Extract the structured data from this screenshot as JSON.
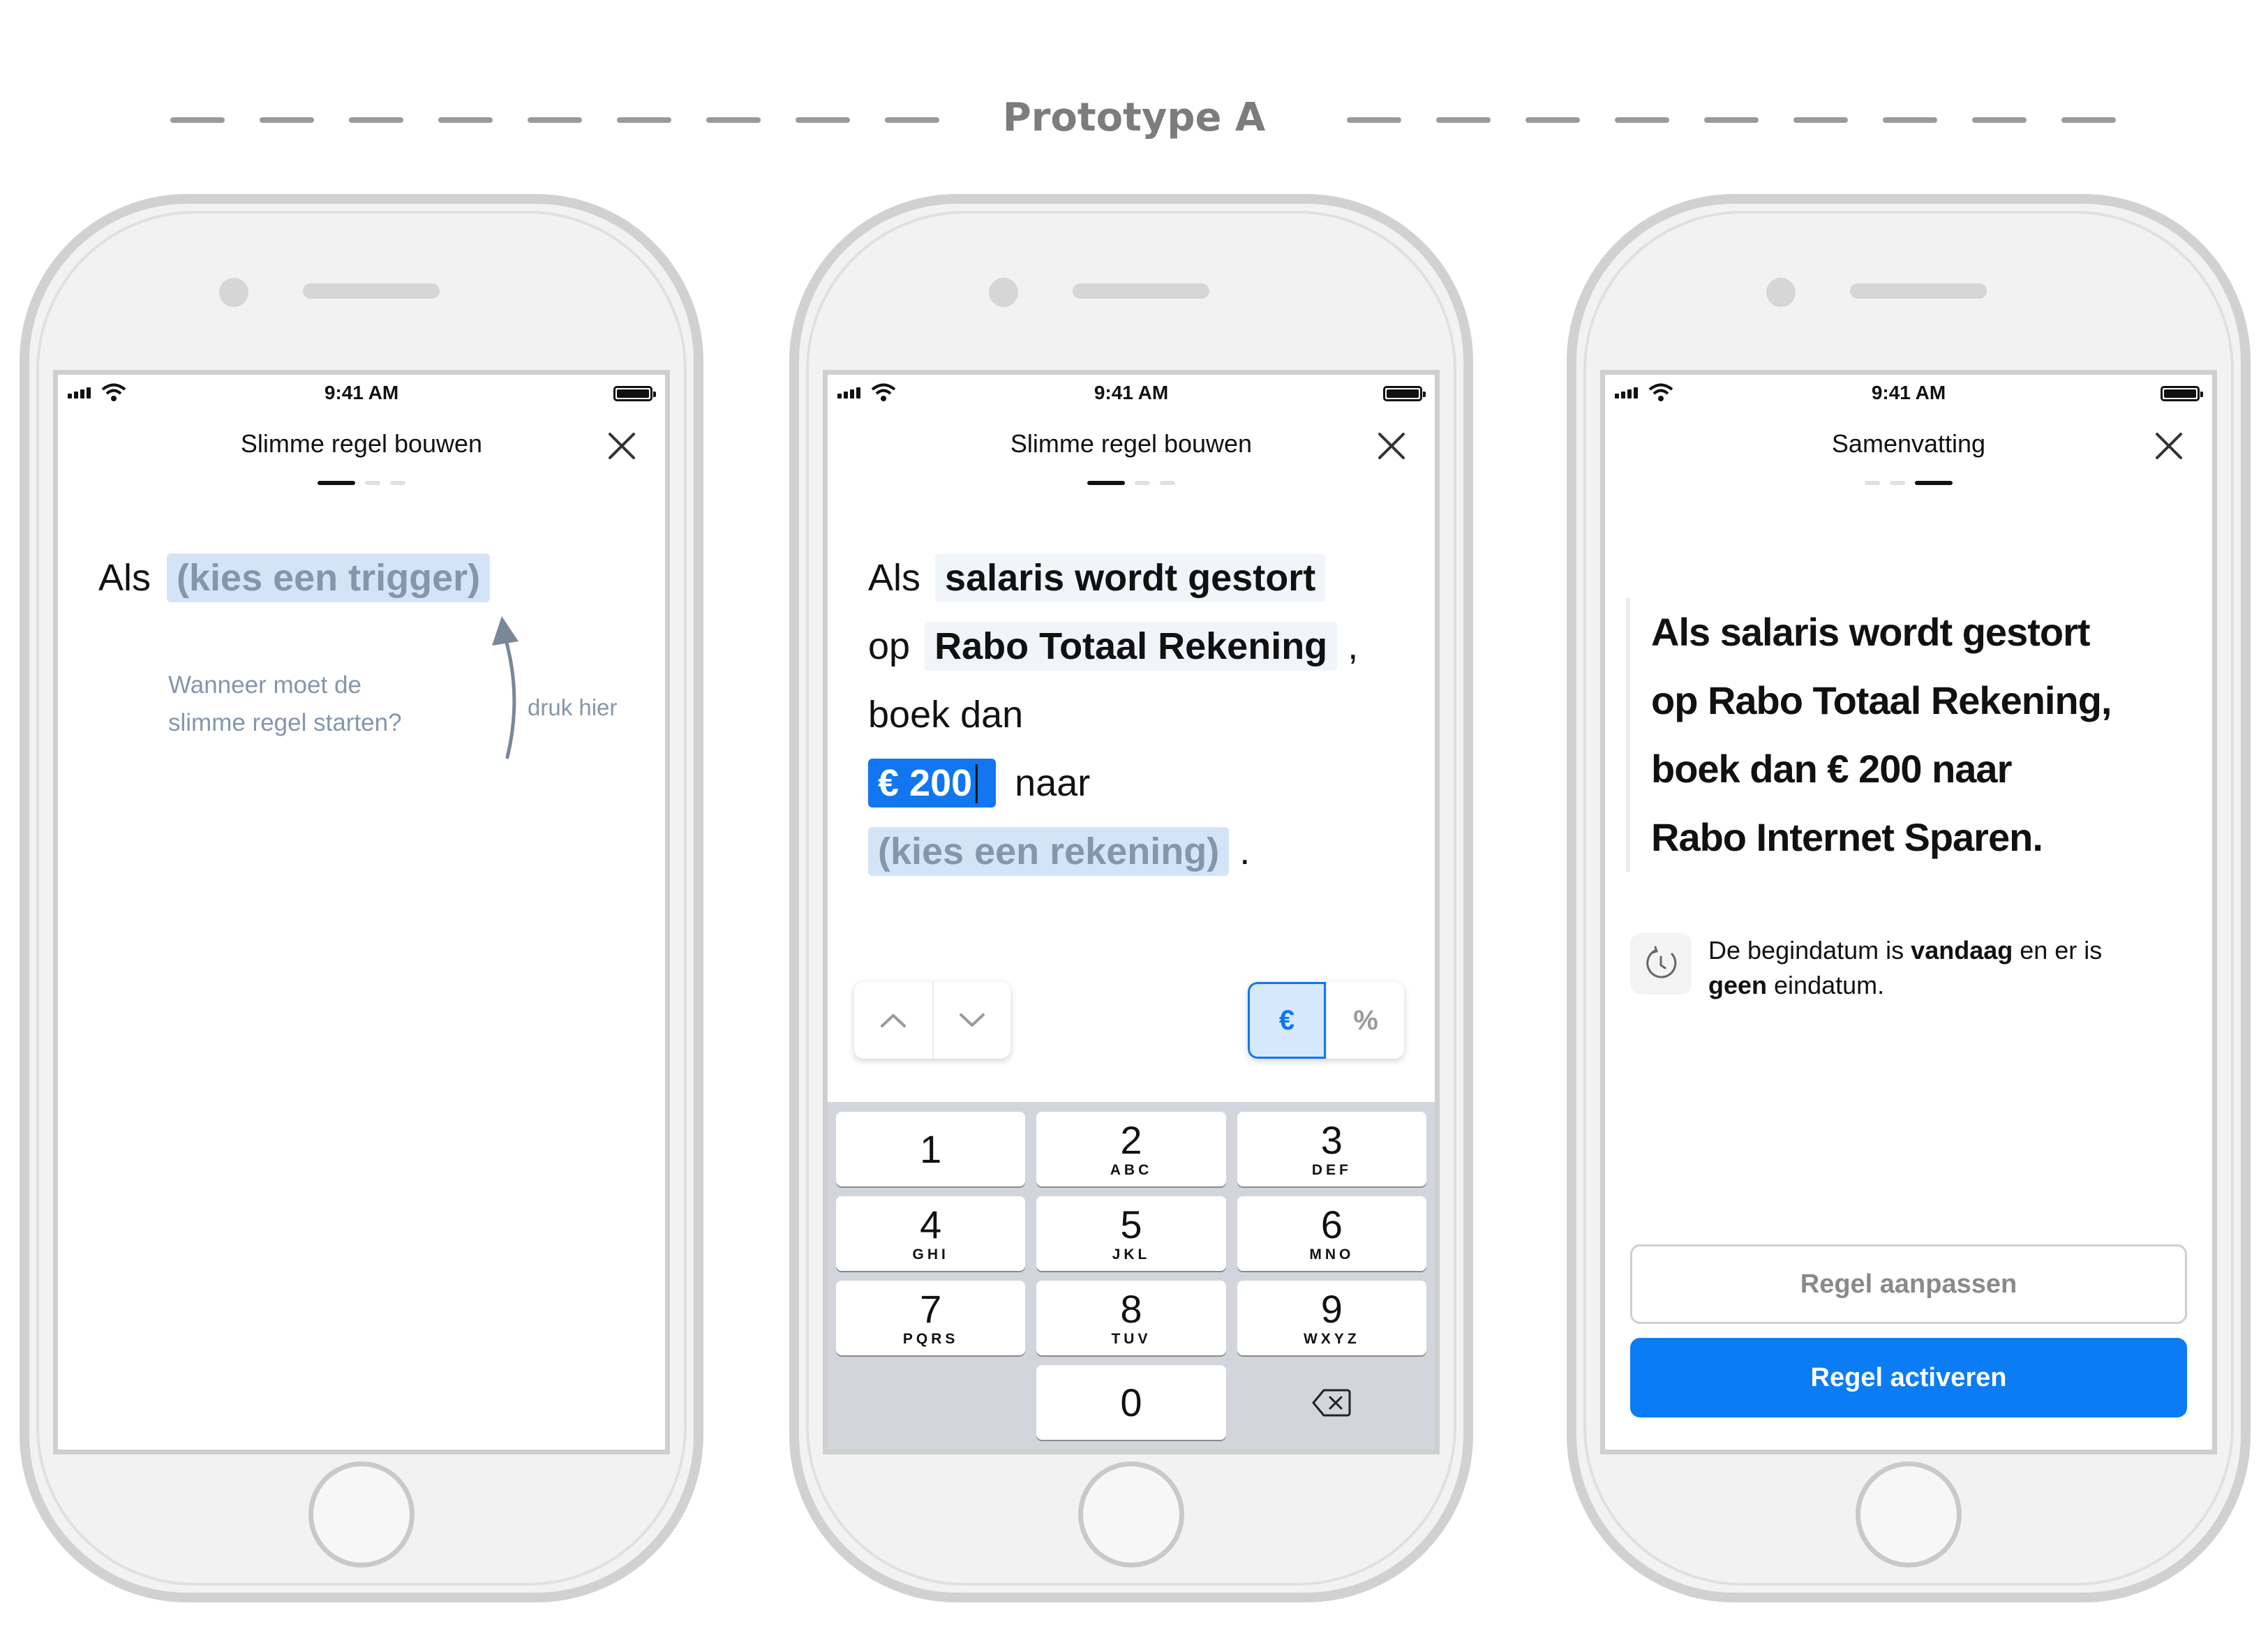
{
  "header": {
    "title": "Prototype A"
  },
  "phones": [
    {
      "status_time": "9:41 AM",
      "nav_title": "Slimme regel bouwen",
      "rule": {
        "prefix": "Als",
        "trigger": "(kies een trigger)"
      },
      "hint": {
        "line1": "Wanneer moet de",
        "line2": "slimme regel starten?",
        "tap": "druk hier"
      }
    },
    {
      "status_time": "9:41 AM",
      "nav_title": "Slimme regel bouwen",
      "rule": {
        "w1": "Als",
        "trigger": "salaris wordt gestort",
        "w2": "op",
        "account": "Rabo Totaal Rekening",
        "comma": ",",
        "w3": "boek dan",
        "amount": "€ 200",
        "w4": "naar",
        "target": "(kies een rekening)",
        "period": "."
      },
      "accessory": {
        "currency": "€",
        "percent": "%"
      },
      "keypad": [
        {
          "num": "1",
          "letters": ""
        },
        {
          "num": "2",
          "letters": "ABC"
        },
        {
          "num": "3",
          "letters": "DEF"
        },
        {
          "num": "4",
          "letters": "GHI"
        },
        {
          "num": "5",
          "letters": "JKL"
        },
        {
          "num": "6",
          "letters": "MNO"
        },
        {
          "num": "7",
          "letters": "PQRS"
        },
        {
          "num": "8",
          "letters": "TUV"
        },
        {
          "num": "9",
          "letters": "WXYZ"
        },
        {
          "num": "0",
          "letters": ""
        }
      ]
    },
    {
      "status_time": "9:41 AM",
      "nav_title": "Samenvatting",
      "summary": {
        "line1": "Als salaris wordt gestort",
        "line2": "op Rabo Totaal Rekening,",
        "line3": "boek dan € 200 naar",
        "line4": "Rabo Internet Sparen."
      },
      "info": {
        "t1": "De begindatum is ",
        "b1": "vandaag",
        "t2": " en er is",
        "b2": "geen",
        "t3": " eindatum."
      },
      "buttons": {
        "secondary": "Regel aanpassen",
        "primary": "Regel activeren"
      }
    }
  ],
  "colors": {
    "accent": "#0b7cf4",
    "placeholder_chip": "#d4e4f7",
    "chip": "#f1f5fa"
  }
}
